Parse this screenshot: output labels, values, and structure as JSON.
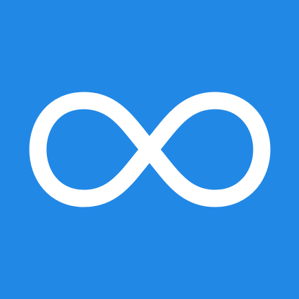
{
  "icon": {
    "name": "infinity-icon",
    "background_color": "#2188e6",
    "symbol_color": "#ffffff"
  }
}
